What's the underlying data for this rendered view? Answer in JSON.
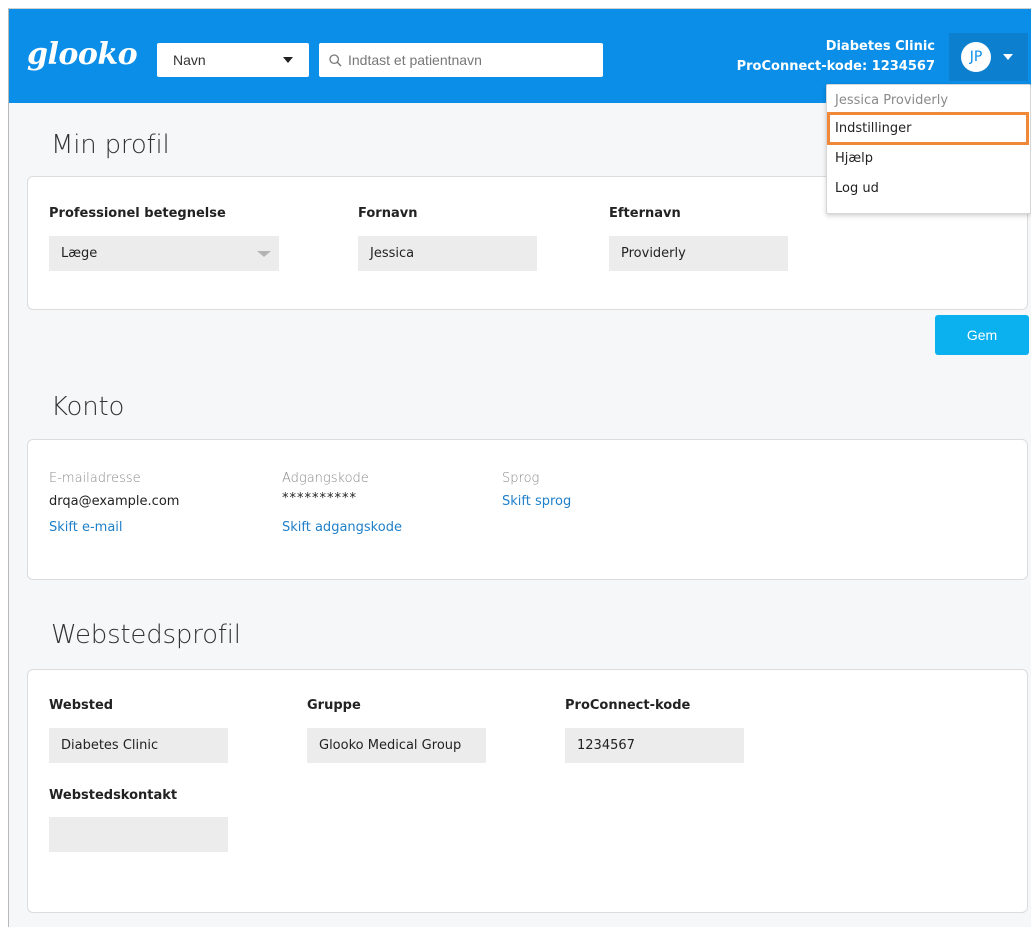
{
  "header": {
    "logo": "glooko",
    "search_type": "Navn",
    "search_placeholder": "Indtast et patientnavn",
    "clinic_name": "Diabetes Clinic",
    "proconnect_line": "ProConnect-kode: 1234567",
    "user_initials": "JP"
  },
  "user_menu": {
    "user_name": "Jessica Providerly",
    "items": [
      "Indstillinger",
      "Hjælp",
      "Log ud"
    ],
    "highlight_color": "#f0883a"
  },
  "profile": {
    "title": "Min profil",
    "title_label": "Professionel betegnelse",
    "title_value": "Læge",
    "first_name_label": "Fornavn",
    "first_name_value": "Jessica",
    "last_name_label": "Efternavn",
    "last_name_value": "Providerly",
    "save_label": "Gem"
  },
  "account": {
    "title": "Konto",
    "email_label": "E-mailadresse",
    "email_value": "drqa@example.com",
    "email_link": "Skift e-mail",
    "password_label": "Adgangskode",
    "password_value": "**********",
    "password_link": "Skift adgangskode",
    "language_label": "Sprog",
    "language_link": "Skift sprog"
  },
  "site_profile": {
    "title": "Webstedsprofil",
    "site_label": "Websted",
    "site_value": "Diabetes Clinic",
    "group_label": "Gruppe",
    "group_value": "Glooko Medical Group",
    "code_label": "ProConnect-kode",
    "code_value": "1234567",
    "contact_label": "Webstedskontakt",
    "contact_value": ""
  },
  "colors": {
    "header_bg": "#0a8ee8",
    "button_bg": "#0bb0ef",
    "link": "#1f7fc9"
  }
}
